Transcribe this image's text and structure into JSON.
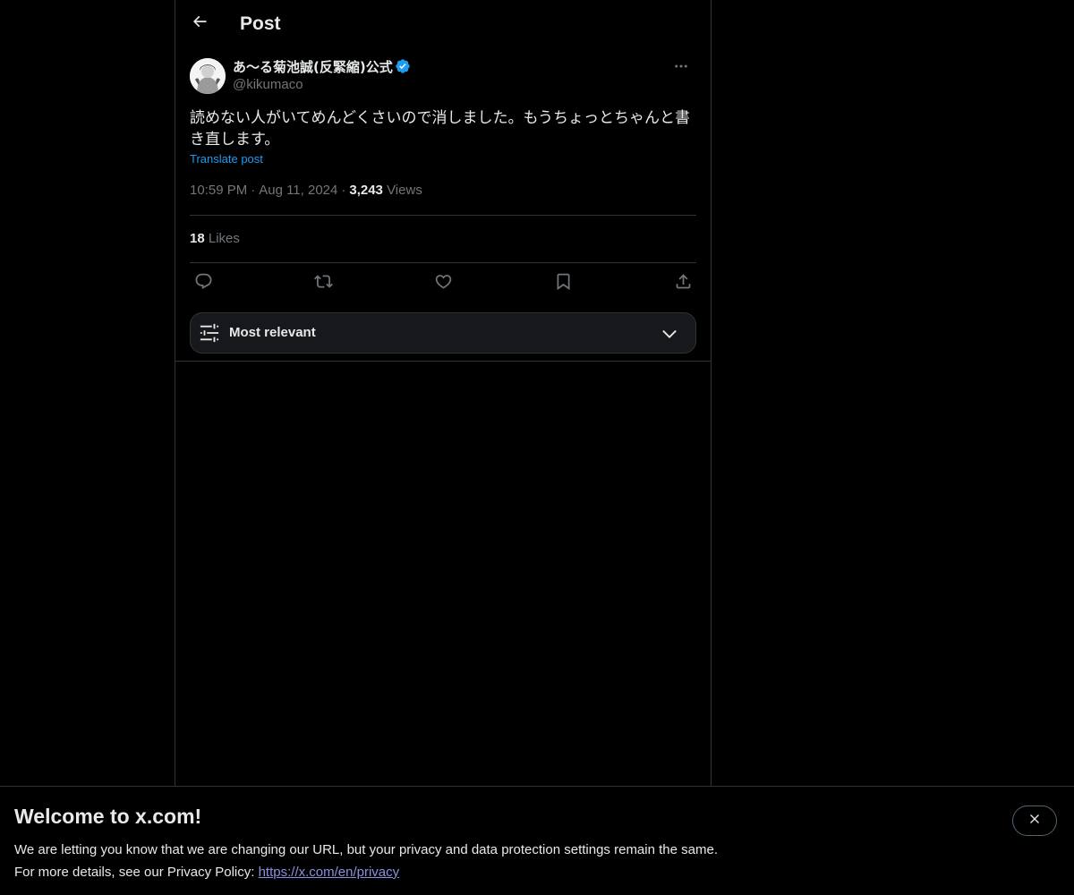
{
  "header": {
    "title": "Post"
  },
  "tweet": {
    "author_name": "あ〜る菊池誠(反緊縮)公式",
    "handle": "@kikumaco",
    "text": "読めない人がいてめんどくさいので消しました。もうちょっとちゃんと書き直します。",
    "translate_label": "Translate post",
    "time": "10:59 PM",
    "date": "Aug 11, 2024",
    "separator": "·",
    "views_count": "3,243",
    "views_label": "Views",
    "likes_count": "18",
    "likes_label": "Likes"
  },
  "sort": {
    "label": "Most relevant"
  },
  "banner": {
    "title": "Welcome to x.com!",
    "line1": "We are letting you know that we are changing our URL, but your privacy and data protection settings remain the same.",
    "line2_prefix": "For more details, see our Privacy Policy: ",
    "link_text": "https://x.com/en/privacy"
  },
  "icons": {
    "back": "arrow-left-icon",
    "more": "ellipsis-icon",
    "verified": "verified-badge-icon",
    "reply": "reply-icon",
    "repost": "repost-icon",
    "like": "heart-icon",
    "bookmark": "bookmark-icon",
    "share": "share-icon",
    "sort": "sliders-icon",
    "chevron": "chevron-down-icon",
    "close": "close-icon"
  },
  "colors": {
    "background": "#000000",
    "text": "#e7e9ea",
    "muted": "#71767b",
    "accent": "#1d9bf0",
    "border": "#2f3336",
    "link": "#8d8ee0"
  }
}
